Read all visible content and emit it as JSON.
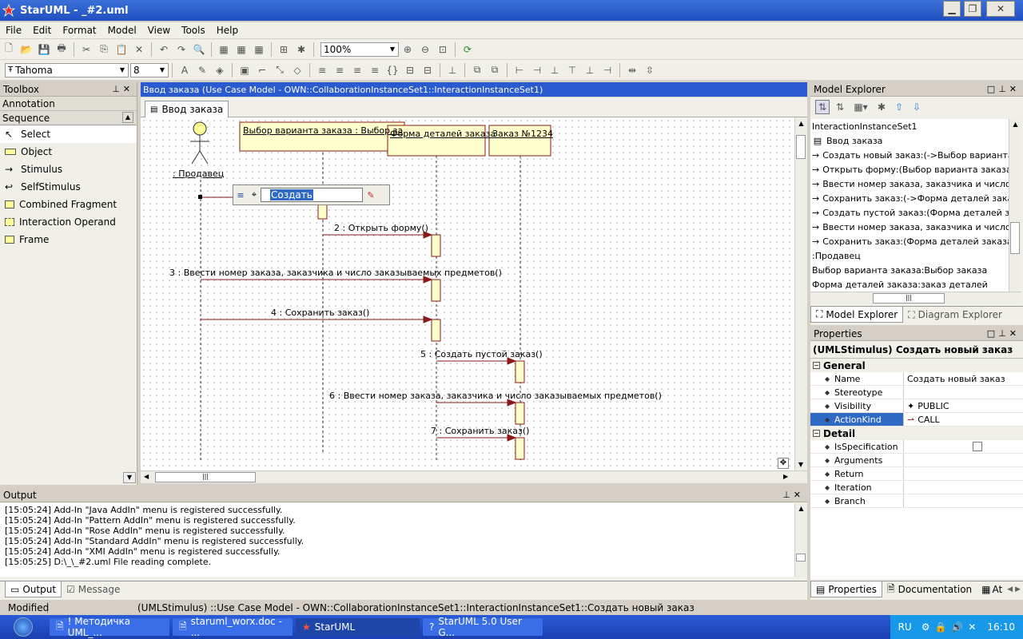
{
  "window": {
    "title": "StarUML - _#2.uml"
  },
  "menu": [
    "File",
    "Edit",
    "Format",
    "Model",
    "View",
    "Tools",
    "Help"
  ],
  "toolbar": {
    "zoom": "100%",
    "font": "Tahoma",
    "font_size": "8"
  },
  "toolbox": {
    "title": "Toolbox",
    "annotation": "Annotation",
    "sequence": "Sequence",
    "items": [
      "Select",
      "Object",
      "Stimulus",
      "SelfStimulus",
      "Combined Fragment",
      "Interaction Operand",
      "Frame"
    ]
  },
  "diagram": {
    "header": "Ввод заказа (Use Case Model - OWN::CollaborationInstanceSet1::InteractionInstanceSet1)",
    "tab": "Ввод заказа",
    "actor": ": Продавец",
    "objects": [
      "Выбор варианта заказа : Выбор заказа",
      "Форма деталей заказа",
      "Заказ №1234"
    ],
    "editor_value": "Создать",
    "messages": [
      "2 : Открыть форму()",
      "3 : Ввести номер заказа, заказчика и число заказываемых предметов()",
      "4 : Сохранить заказ()",
      "5 : Создать пустой заказ()",
      "6 : Ввести номер заказа, заказчика и число заказываемых предметов()",
      "7 : Сохранить заказ()"
    ]
  },
  "model_explorer": {
    "title": "Model Explorer",
    "items": [
      "InteractionInstanceSet1",
      "Ввод заказа",
      "Создать новый заказ:(->Выбор варианта за",
      "Открыть форму:(Выбор варианта заказа->Ф",
      "Ввести номер заказа, заказчика и число зак",
      "Сохранить заказ:(->Форма деталей заказа)",
      "Создать пустой заказ:(Форма деталей заказ",
      "Ввести номер заказа, заказчика и число зак",
      "Сохранить заказ:(Форма деталей заказа->З",
      ":Продавец",
      "Выбор варианта заказа:Выбор заказа",
      "Форма деталей заказа:заказ деталей"
    ],
    "tabs": [
      "Model Explorer",
      "Diagram Explorer"
    ]
  },
  "properties": {
    "title": "Properties",
    "heading": "(UMLStimulus) Создать новый заказ",
    "groups": {
      "general": "General",
      "detail": "Detail"
    },
    "general": [
      {
        "name": "Name",
        "value": "Создать новый заказ"
      },
      {
        "name": "Stereotype",
        "value": ""
      },
      {
        "name": "Visibility",
        "value": "PUBLIC"
      },
      {
        "name": "ActionKind",
        "value": "CALL"
      }
    ],
    "detail": [
      {
        "name": "IsSpecification",
        "value": ""
      },
      {
        "name": "Arguments",
        "value": ""
      },
      {
        "name": "Return",
        "value": ""
      },
      {
        "name": "Iteration",
        "value": ""
      },
      {
        "name": "Branch",
        "value": ""
      }
    ],
    "tabs": [
      "Properties",
      "Documentation",
      "At"
    ]
  },
  "output": {
    "title": "Output",
    "lines": [
      "[15:05:24]  Add-In \"Java AddIn\" menu is registered successfully.",
      "[15:05:24]  Add-In \"Pattern AddIn\" menu is registered successfully.",
      "[15:05:24]  Add-In \"Rose AddIn\" menu is registered successfully.",
      "[15:05:24]  Add-In \"Standard AddIn\" menu is registered successfully.",
      "[15:05:24]  Add-In \"XMI AddIn\" menu is registered successfully.",
      "[15:05:25]  D:\\_\\_#2.uml File reading complete."
    ],
    "tabs": [
      "Output",
      "Message"
    ]
  },
  "status": {
    "state": "Modified",
    "path": "(UMLStimulus) ::Use Case Model - OWN::CollaborationInstanceSet1::InteractionInstanceSet1::Создать новый заказ"
  },
  "taskbar": {
    "tasks": [
      "! Методичка UML_...",
      "staruml_worx.doc - ...",
      "StarUML",
      "StarUML 5.0 User G..."
    ],
    "lang": "RU",
    "time": "16:10"
  }
}
